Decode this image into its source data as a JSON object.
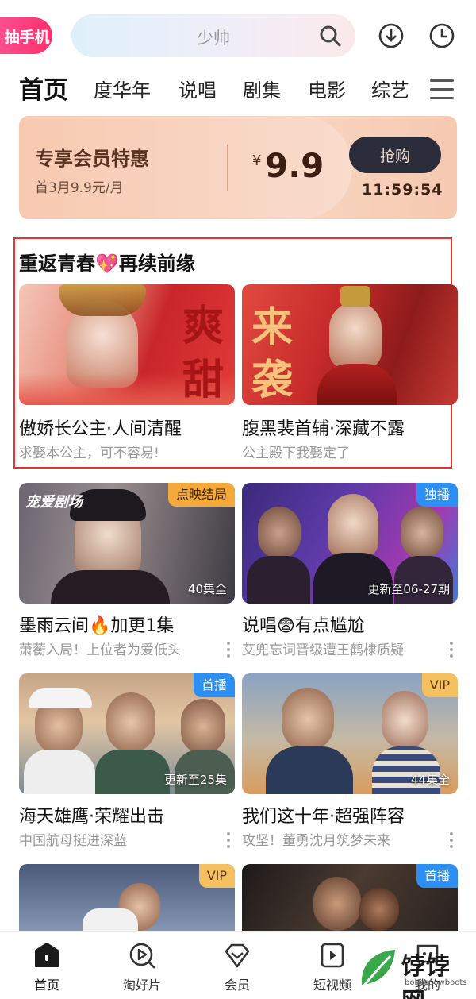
{
  "topbar": {
    "promo_label": "抽手机",
    "search_placeholder": "少帅"
  },
  "nav": {
    "tabs": [
      {
        "label": "首页",
        "active": true
      },
      {
        "label": "度华年"
      },
      {
        "label": "说唱"
      },
      {
        "label": "剧集"
      },
      {
        "label": "电影"
      },
      {
        "label": "综艺"
      }
    ]
  },
  "banner": {
    "title": "专享会员特惠",
    "subtitle": "首3月9.9元/月",
    "currency": "¥",
    "price": "9.9",
    "button": "抢购",
    "countdown": "11:59:54"
  },
  "section": {
    "title": "重返青春💖再续前缘",
    "cards": [
      {
        "title": "傲娇长公主·人间清醒",
        "subtitle": "求娶本公主，可不容易!",
        "poster_text": [
          "爽",
          "甜"
        ]
      },
      {
        "title": "腹黑裴首辅·深藏不露",
        "subtitle": "公主殿下我娶定了",
        "poster_text": [
          "来",
          "袭"
        ]
      }
    ]
  },
  "grid": [
    {
      "title": "墨雨云间🔥加更1集",
      "subtitle": "萧蘅入局！上位者为爱低头",
      "badge": "点映结局",
      "overlay": "40集全",
      "brand": "宠爱剧场",
      "badge_color": "#f4a93a"
    },
    {
      "title": "说唱😨有点尴尬",
      "subtitle": "艾兜忘词晋级遭王鹤棣质疑",
      "badge": "独播",
      "overlay": "更新至06-27期",
      "badge_color": "#2c8ff3"
    },
    {
      "title": "海天雄鹰·荣耀出击",
      "subtitle": "中国航母挺进深蓝",
      "badge": "首播",
      "overlay": "更新至25集",
      "badge_color": "#2c8ff3"
    },
    {
      "title": "我们这十年·超强阵容",
      "subtitle": "攻坚！董勇沈月筑梦未来",
      "badge": "VIP",
      "overlay": "44集全",
      "badge_color": "#f4c060"
    },
    {
      "badge": "VIP",
      "badge_color": "#f4c060"
    },
    {
      "badge": "首播",
      "badge_color": "#2c8ff3"
    }
  ],
  "bottom_nav": [
    {
      "label": "首页",
      "icon": "home-icon",
      "active": true
    },
    {
      "label": "淘好片",
      "icon": "play-circle-icon"
    },
    {
      "label": "会员",
      "icon": "diamond-icon"
    },
    {
      "label": "短视频",
      "icon": "video-icon"
    },
    {
      "label": "我的",
      "icon": "chat-icon"
    }
  ],
  "watermark": {
    "text": "饽饽网",
    "url": "bobosnowboots"
  }
}
